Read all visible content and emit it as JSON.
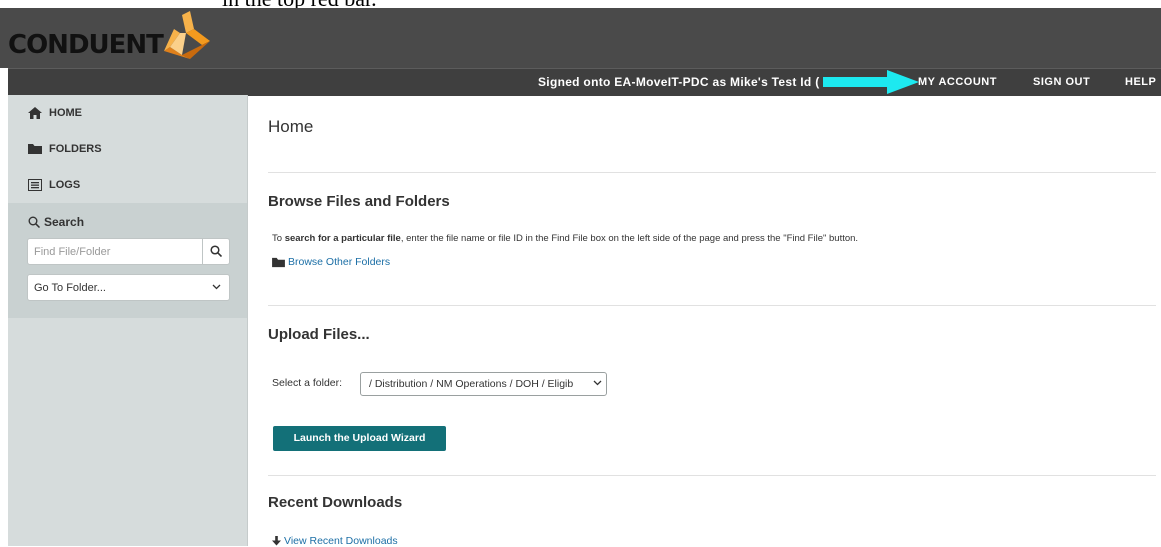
{
  "top_caption": "in the top red bar.",
  "brand": {
    "name": "CONDUENT",
    "colors": {
      "orange": "#f39a1e",
      "dark_orange": "#c86a0e",
      "header_bg": "#4a4a4a",
      "teal": "#137078",
      "arrow": "#1de9f0"
    }
  },
  "topbar": {
    "signed_text": "Signed onto EA-MoveIT-PDC as Mike's Test Id (",
    "links": {
      "account": "MY ACCOUNT",
      "signout": "SIGN OUT",
      "help": "HELP"
    }
  },
  "sidebar": {
    "items": [
      {
        "label": "HOME",
        "icon": "home-icon"
      },
      {
        "label": "FOLDERS",
        "icon": "folder-icon"
      },
      {
        "label": "LOGS",
        "icon": "list-icon"
      }
    ],
    "search": {
      "title": "Search",
      "placeholder": "Find File/Folder",
      "goto": "Go To Folder..."
    }
  },
  "main": {
    "title": "Home",
    "browse": {
      "heading": "Browse Files and Folders",
      "instr_pre": "To ",
      "instr_bold": "search for a particular file",
      "instr_post": ", enter the file name or file ID in the Find File box on the left side of the page and press the \"Find File\" button.",
      "link": "Browse Other Folders"
    },
    "upload": {
      "heading": "Upload Files...",
      "select_label": "Select a folder:",
      "select_value": "/ Distribution / NM Operations / DOH / Eligib",
      "button": "Launch the Upload Wizard"
    },
    "recent": {
      "heading": "Recent Downloads",
      "link": "View Recent Downloads"
    }
  }
}
